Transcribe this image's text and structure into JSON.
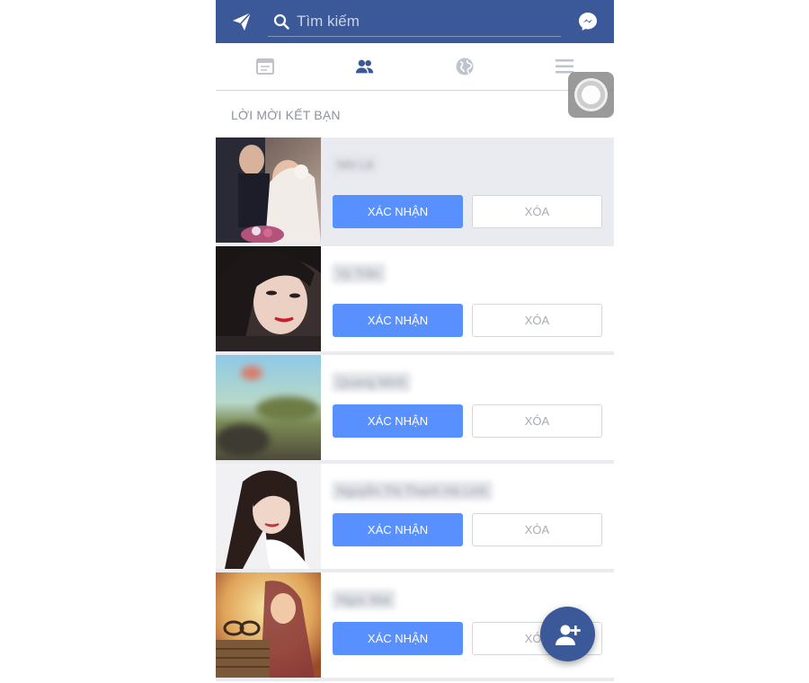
{
  "header": {
    "search_placeholder": "Tìm kiếm",
    "bar_color": "#3b5998"
  },
  "tabs": [
    {
      "icon": "news-feed-icon",
      "active": false
    },
    {
      "icon": "friends-icon",
      "active": true
    },
    {
      "icon": "globe-icon",
      "active": false
    },
    {
      "icon": "menu-icon",
      "active": false
    }
  ],
  "section": {
    "title": "LỜI MỜI KẾT BẠN"
  },
  "requests": [
    {
      "name": "Nhi Lê",
      "photo": "wedding-couple-photo",
      "confirm_label": "XÁC NHẬN",
      "delete_label": "XÓA",
      "highlighted": true
    },
    {
      "name": "Vy Trần",
      "photo": "girl-portrait-photo",
      "confirm_label": "XÁC NHẬN",
      "delete_label": "XÓA",
      "highlighted": false
    },
    {
      "name": "Quang Minh",
      "photo": "blurred-landscape-photo",
      "confirm_label": "XÁC NHẬN",
      "delete_label": "XÓA",
      "highlighted": false
    },
    {
      "name": "Nguyễn Thị Thanh Hà Linh",
      "photo": "long-hair-girl-photo",
      "confirm_label": "XÁC NHẬN",
      "delete_label": "XÓA",
      "highlighted": false
    },
    {
      "name": "Ngọc Mai",
      "photo": "vintage-girl-photo",
      "confirm_label": "XÁC NHẬN",
      "delete_label": "XÓA",
      "highlighted": false
    }
  ],
  "colors": {
    "confirm_button": "#5890ff",
    "accent": "#3b5998"
  }
}
